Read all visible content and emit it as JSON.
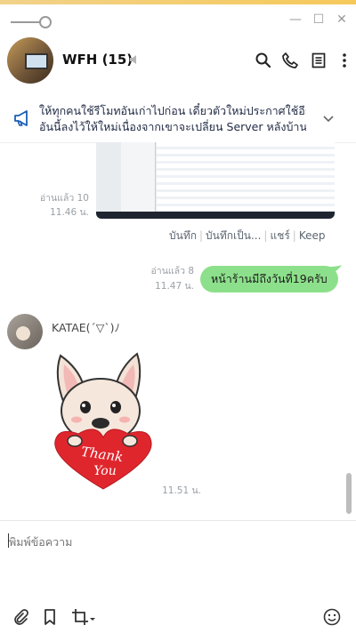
{
  "window": {
    "minimize": "—",
    "maximize": "☐",
    "close": "✕"
  },
  "header": {
    "title": "WFH (15)"
  },
  "announcement": {
    "line1": "ให้ทุกคนใช้รีโมทอันเก่าไปก่อน เดี๋ยวตัวใหม่ประกาศใช้อีกที",
    "line2": "อันนี้ลงไว้ให้ใหม่เนื่องจากเขาจะเปลี่ยน Server หลังบ้าน เ..."
  },
  "messages": {
    "image_read": "อ่านแล้ว 10",
    "image_time": "11.46 น.",
    "actions": [
      "บันทึก",
      "บันทึกเป็น...",
      "แชร์",
      "Keep"
    ],
    "outgoing_read": "อ่านแล้ว 8",
    "outgoing_time": "11.47 น.",
    "outgoing_text": "หน้าร้านมีถึงวันที่19ครับ",
    "sender_name": "KATAE(´▽`)ﾉ",
    "sticker_text_1": "Thank",
    "sticker_text_2": "You",
    "sticker_time": "11.51 น."
  },
  "input": {
    "placeholder": "พิมพ์ข้อความ"
  },
  "colors": {
    "bubble_out": "#8de08b",
    "accent_bar": "#f6c95a",
    "icon_blue": "#1a5fb4"
  }
}
